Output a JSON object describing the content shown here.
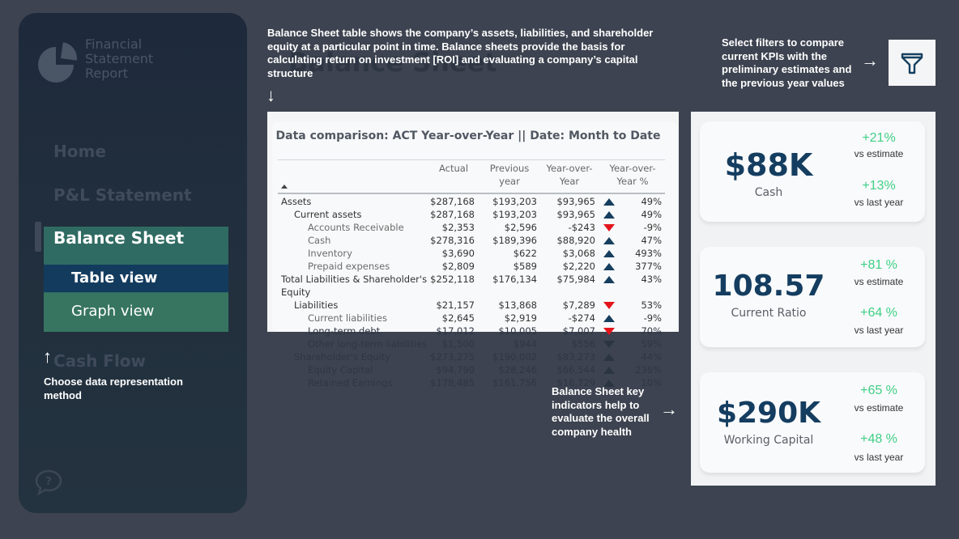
{
  "app": {
    "logo_text": "Financial Statement Report",
    "page_title": "Balance Sheet"
  },
  "sidebar": {
    "items": [
      {
        "label": "Home"
      },
      {
        "label": "P&L Statement"
      },
      {
        "label": "Balance Sheet",
        "active": true
      },
      {
        "label": "Cash Flow"
      }
    ],
    "subitems": [
      {
        "label": "Table view",
        "active": true
      },
      {
        "label": "Graph view"
      }
    ],
    "help_icon": "help-chat-icon"
  },
  "annotations": {
    "top": "Balance Sheet table shows the company’s assets, liabilities, and shareholder equity at a particular point in time. Balance sheets provide the basis for calculating return on investment [ROI] and evaluating a company’s capital structure",
    "filters": "Select filters to compare current KPIs with the preliminary estimates and the previous year values",
    "choose": "Choose data representation method",
    "kpis": "Balance Sheet key indicators help to evaluate the overall company health",
    "arrow_down": "↓",
    "arrow_right": "→",
    "arrow_up": "↑"
  },
  "colors": {
    "background": "#3d4350",
    "sidebar": "#1f2b3a",
    "active_nav": "#2f6b62",
    "active_subnav": "#133b5e",
    "positive": "#3fcf86",
    "negative_marker": "#e3141c",
    "positive_marker": "#163f5f",
    "kpi_value": "#143d60"
  },
  "table": {
    "title": "Data comparison: ACT Year-over-Year || Date: Month to Date",
    "columns": [
      "Actual",
      "Previous year",
      "Year-over-Year",
      "Year-over-Year %"
    ],
    "rows": [
      {
        "label": "Assets",
        "level": 0,
        "actual": "$287,168",
        "previous": "$193,203",
        "yoy": "$93,965",
        "trend": "up",
        "pct": "49%"
      },
      {
        "label": "Current assets",
        "level": 1,
        "actual": "$287,168",
        "previous": "$193,203",
        "yoy": "$93,965",
        "trend": "up",
        "pct": "49%"
      },
      {
        "label": "Accounts Receivable",
        "level": 2,
        "actual": "$2,353",
        "previous": "$2,596",
        "yoy": "-$243",
        "trend": "down",
        "pct": "-9%"
      },
      {
        "label": "Cash",
        "level": 2,
        "actual": "$278,316",
        "previous": "$189,396",
        "yoy": "$88,920",
        "trend": "up",
        "pct": "47%"
      },
      {
        "label": "Inventory",
        "level": 2,
        "actual": "$3,690",
        "previous": "$622",
        "yoy": "$3,068",
        "trend": "up",
        "pct": "493%"
      },
      {
        "label": "Prepaid expenses",
        "level": 2,
        "actual": "$2,809",
        "previous": "$589",
        "yoy": "$2,220",
        "trend": "up",
        "pct": "377%"
      },
      {
        "label": "Total Liabilities & Shareholder's",
        "label2": "Equity",
        "level": 0,
        "actual": "$252,118",
        "previous": "$176,134",
        "yoy": "$75,984",
        "trend": "up",
        "pct": "43%"
      },
      {
        "label": "Liabilities",
        "level": 1,
        "actual": "$21,157",
        "previous": "$13,868",
        "yoy": "$7,289",
        "trend": "down",
        "pct": "53%"
      },
      {
        "label": "Current liabilities",
        "level": 2,
        "actual": "$2,645",
        "previous": "$2,919",
        "yoy": "-$274",
        "trend": "up",
        "pct": "-9%"
      },
      {
        "label": "Long-term debt",
        "level": 2,
        "actual": "$17,012",
        "previous": "$10,005",
        "yoy": "$7,007",
        "trend": "down",
        "pct": "70%"
      },
      {
        "label": "Other long-term liabilities",
        "level": 2,
        "actual": "$1,500",
        "previous": "$944",
        "yoy": "$556",
        "trend": "down",
        "pct": "59%"
      },
      {
        "label": "Shareholder's Equity",
        "level": 1,
        "actual": "$273,275",
        "previous": "$190,002",
        "yoy": "$83,273",
        "trend": "up",
        "pct": "44%"
      },
      {
        "label": "Equity Capital",
        "level": 2,
        "actual": "$94,790",
        "previous": "$28,246",
        "yoy": "$66,544",
        "trend": "up",
        "pct": "236%"
      },
      {
        "label": "Retained Earnings",
        "level": 2,
        "actual": "$178,485",
        "previous": "$161,756",
        "yoy": "$16,729",
        "trend": "up",
        "pct": "10%"
      }
    ]
  },
  "kpis": [
    {
      "value": "$88K",
      "label": "Cash",
      "vs_estimate": "+21%",
      "vs_estimate_label": "vs estimate",
      "vs_last_year": "+13%",
      "vs_last_year_label": "vs last year"
    },
    {
      "value": "108.57",
      "label": "Current Ratio",
      "vs_estimate": "+81 %",
      "vs_estimate_label": "vs estimate",
      "vs_last_year": "+64 %",
      "vs_last_year_label": "vs last year"
    },
    {
      "value": "$290K",
      "label": "Working Capital",
      "vs_estimate": "+65 %",
      "vs_estimate_label": "vs estimate",
      "vs_last_year": "+48 %",
      "vs_last_year_label": "vs last year"
    }
  ],
  "filter_button": {
    "icon": "filter-funnel-icon"
  }
}
